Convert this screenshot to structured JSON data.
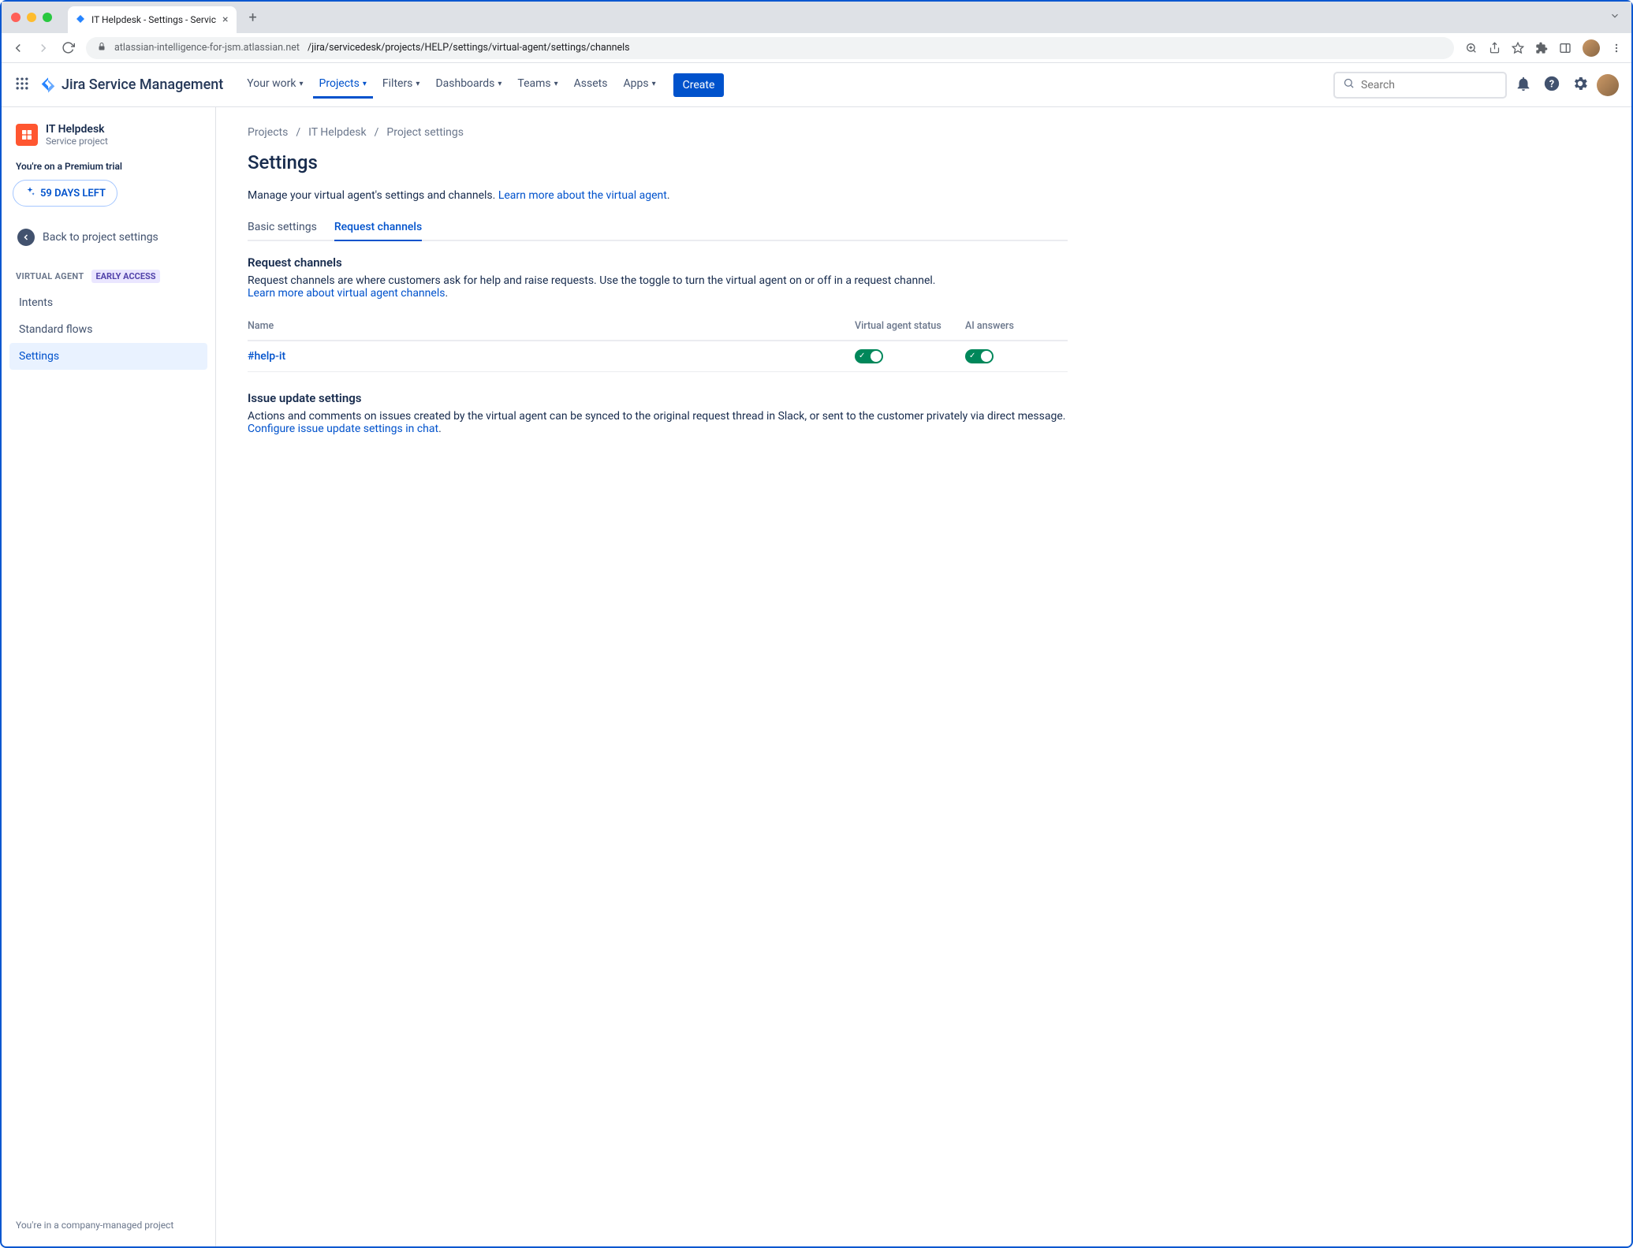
{
  "browser": {
    "tab_title": "IT Helpdesk - Settings - Servic",
    "url_host": "atlassian-intelligence-for-jsm.atlassian.net",
    "url_path": "/jira/servicedesk/projects/HELP/settings/virtual-agent/settings/channels"
  },
  "nav": {
    "product": "Jira Service Management",
    "items": [
      "Your work",
      "Projects",
      "Filters",
      "Dashboards",
      "Teams",
      "Assets",
      "Apps"
    ],
    "active_index": 1,
    "create": "Create",
    "search_placeholder": "Search"
  },
  "sidebar": {
    "project_name": "IT Helpdesk",
    "project_type": "Service project",
    "trial_line": "You're on a Premium trial",
    "days_left": "59 DAYS LEFT",
    "back": "Back to project settings",
    "section": "VIRTUAL AGENT",
    "early_access": "EARLY ACCESS",
    "items": [
      "Intents",
      "Standard flows",
      "Settings"
    ],
    "active_index": 2,
    "footer": "You're in a company-managed project"
  },
  "breadcrumbs": [
    "Projects",
    "IT Helpdesk",
    "Project settings"
  ],
  "page": {
    "title": "Settings",
    "lead_text": "Manage your virtual agent's settings and channels. ",
    "lead_link": "Learn more about the virtual agent",
    "tabs": [
      "Basic settings",
      "Request channels"
    ],
    "active_tab": 1,
    "rc": {
      "heading": "Request channels",
      "desc": "Request channels are where customers ask for help and raise requests. Use the toggle to turn the virtual agent on or off in a request channel. ",
      "desc_link": "Learn more about virtual agent channels",
      "columns": {
        "name": "Name",
        "status": "Virtual agent status",
        "ai": "AI answers"
      },
      "rows": [
        {
          "name": "#help-it",
          "status": true,
          "ai": true
        }
      ]
    },
    "issue": {
      "heading": "Issue update settings",
      "desc": "Actions and comments on issues created by the virtual agent can be synced to the original request thread in Slack, or sent to the customer privately via direct message. ",
      "link": "Configure issue update settings in chat"
    }
  }
}
